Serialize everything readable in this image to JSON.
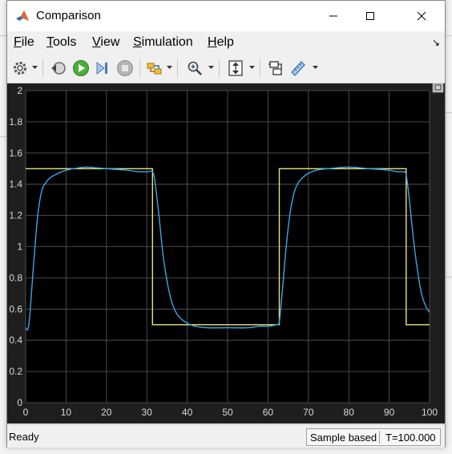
{
  "window": {
    "title": "Comparison"
  },
  "menu": [
    {
      "label": "File",
      "accel": "F",
      "rest": "ile"
    },
    {
      "label": "Tools",
      "accel": "T",
      "rest": "ools"
    },
    {
      "label": "View",
      "accel": "V",
      "rest": "iew"
    },
    {
      "label": "Simulation",
      "accel": "S",
      "rest": "imulation"
    },
    {
      "label": "Help",
      "accel": "H",
      "rest": "elp"
    }
  ],
  "toolbar_icons": [
    "configuration-gear-icon",
    "step-back-icon",
    "run-icon",
    "step-forward-icon",
    "stop-icon",
    "signal-selector-icon",
    "zoom-icon",
    "autoscale-icon",
    "highlight-block-icon",
    "measurement-ruler-icon"
  ],
  "status": {
    "ready": "Ready",
    "sample": "Sample based",
    "time": "T=100.000"
  },
  "colors": {
    "plot_bg": "#000000",
    "frame_bg": "#1e1e1e",
    "grid": "#5a5a5a",
    "reference": "#e6e67a",
    "response": "#3ba6e8",
    "axis_text": "#d8d8d8"
  },
  "chart_data": {
    "type": "line",
    "xlim": [
      0,
      100
    ],
    "ylim": [
      0,
      2
    ],
    "x_ticks": [
      0,
      10,
      20,
      30,
      40,
      50,
      60,
      70,
      80,
      90,
      100
    ],
    "y_ticks": [
      0,
      0.2,
      0.4,
      0.6,
      0.8,
      1,
      1.2,
      1.4,
      1.6,
      1.8,
      2
    ],
    "x_tick_labels": [
      "0",
      "10",
      "20",
      "30",
      "40",
      "50",
      "60",
      "70",
      "80",
      "90",
      "100"
    ],
    "y_tick_labels": [
      "0",
      "0.2",
      "0.4",
      "0.6",
      "0.8",
      "1",
      "1.2",
      "1.4",
      "1.6",
      "1.8",
      "2"
    ],
    "grid": true,
    "series": [
      {
        "color": "#e6e67a",
        "x": [
          0,
          31.4,
          31.4,
          62.8,
          62.8,
          94.2,
          94.2,
          100
        ],
        "y": [
          1.5,
          1.5,
          0.5,
          0.5,
          1.5,
          1.5,
          0.5,
          0.5
        ]
      },
      {
        "color": "#3ba6e8",
        "x": [
          0,
          0.5,
          1,
          2,
          3,
          4,
          5,
          6,
          8,
          10,
          12,
          15,
          20,
          25,
          28,
          30,
          31.4,
          32,
          33,
          34,
          35,
          36,
          37,
          38,
          40,
          42,
          45,
          50,
          55,
          58,
          60,
          62,
          62.8,
          63.5,
          64.5,
          65.5,
          66.5,
          67.5,
          68.5,
          70,
          72,
          75,
          80,
          85,
          90,
          92,
          93.5,
          94.2,
          95,
          96,
          97,
          98,
          99,
          100
        ],
        "y": [
          0.48,
          0.47,
          0.55,
          0.9,
          1.2,
          1.36,
          1.41,
          1.44,
          1.47,
          1.49,
          1.5,
          1.51,
          1.5,
          1.49,
          1.48,
          1.48,
          1.48,
          1.42,
          1.2,
          0.95,
          0.78,
          0.66,
          0.59,
          0.55,
          0.51,
          0.49,
          0.48,
          0.48,
          0.48,
          0.49,
          0.49,
          0.5,
          0.52,
          0.7,
          1.0,
          1.22,
          1.35,
          1.41,
          1.44,
          1.47,
          1.49,
          1.5,
          1.51,
          1.5,
          1.49,
          1.48,
          1.48,
          1.46,
          1.3,
          1.05,
          0.85,
          0.7,
          0.62,
          0.58
        ]
      }
    ]
  }
}
